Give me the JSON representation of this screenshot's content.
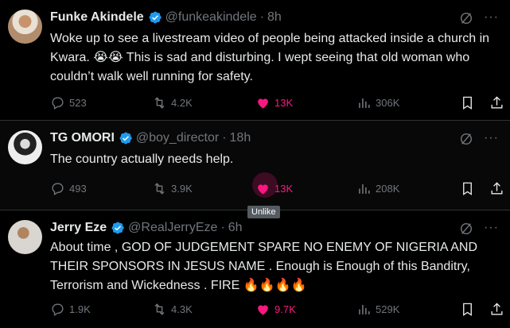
{
  "colors": {
    "background": "#000000",
    "text": "#e7e9ea",
    "muted": "#71767b",
    "like": "#f91880",
    "verified": "#1d9bf0",
    "border": "#2f3336"
  },
  "tweets": [
    {
      "name": "Funke Akindele",
      "handle": "@funkeakindele",
      "time": "8h",
      "text_1": "Woke up to see a livestream video of people being attacked inside a church in Kwara. ",
      "emojis_1": "😭😭",
      "text_2": " This is sad and disturbing. I wept seeing that old woman who couldn’t walk well running for safety.",
      "replies": "523",
      "retweets": "4.2K",
      "likes": "13K",
      "views": "306K",
      "liked": true
    },
    {
      "name": "TG OMORI",
      "handle": "@boy_director",
      "time": "18h",
      "text_1": "The country actually needs help.",
      "replies": "493",
      "retweets": "3.9K",
      "likes": "13K",
      "views": "208K",
      "liked": true
    },
    {
      "name": "Jerry Eze",
      "handle": "@RealJerryEze",
      "time": "6h",
      "text_1": "About time , GOD OF JUDGEMENT SPARE NO ENEMY OF NIGERIA AND THEIR SPONSORS  IN JESUS NAME . Enough is Enough of this Banditry, Terrorism and Wickedness . FIRE ",
      "emojis_1": "🔥🔥🔥🔥",
      "replies": "1.9K",
      "retweets": "4.3K",
      "likes": "9.7K",
      "views": "529K",
      "liked": true
    }
  ],
  "tooltip": "Unlike",
  "icons": [
    "verified-badge-icon",
    "grok-icon",
    "more-icon",
    "reply-icon",
    "retweet-icon",
    "heart-icon",
    "views-icon",
    "bookmark-icon",
    "share-icon"
  ]
}
